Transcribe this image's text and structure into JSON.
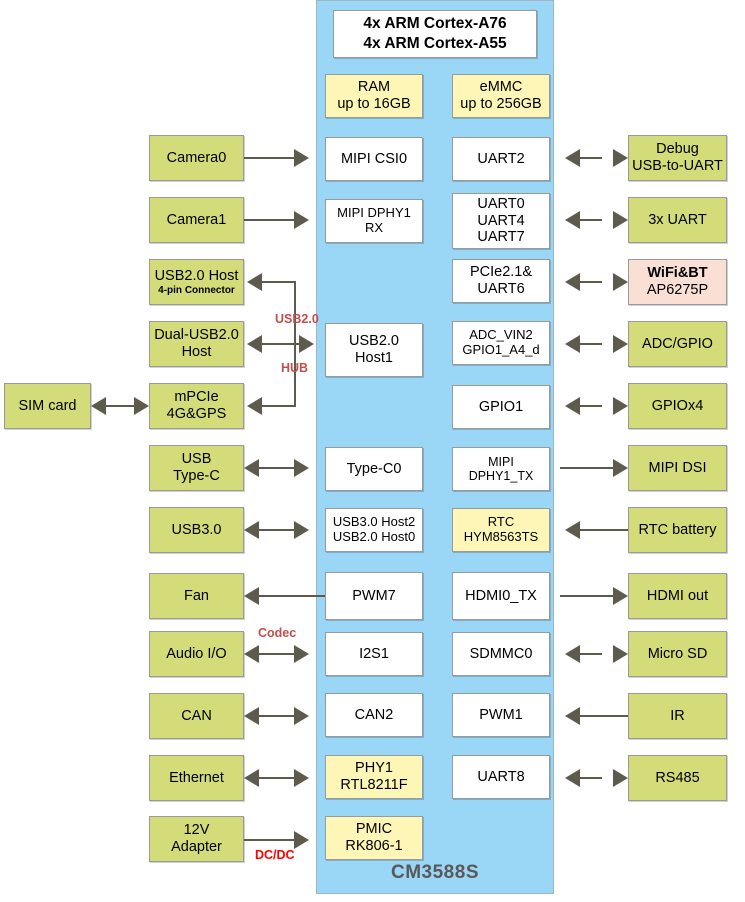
{
  "soc": {
    "name": "CM3588S",
    "panel_color": "#9ad6f5",
    "cpu": {
      "line1": "4x ARM Cortex-A76",
      "line2": "4x ARM Cortex-A55"
    },
    "memory": [
      {
        "id": "ram",
        "line1": "RAM",
        "line2": "up to 16GB"
      },
      {
        "id": "emmc",
        "line1": "eMMC",
        "line2": "up to 256GB"
      }
    ],
    "inner_left": [
      {
        "id": "mipi-csi0",
        "line1": "MIPI CSI0"
      },
      {
        "id": "mipi-dphy1-rx",
        "line1": "MIPI DPHY1 RX"
      },
      {
        "id": "usb20-host1",
        "line1": "USB2.0",
        "line2": "Host1"
      },
      {
        "id": "type-c0",
        "line1": "Type-C0"
      },
      {
        "id": "usb3-host2",
        "line1": "USB3.0 Host2",
        "line2": "USB2.0 Host0"
      },
      {
        "id": "pwm7",
        "line1": "PWM7"
      },
      {
        "id": "i2s1",
        "line1": "I2S1"
      },
      {
        "id": "can2",
        "line1": "CAN2"
      },
      {
        "id": "phy1",
        "line1": "PHY1",
        "line2": "RTL8211F"
      },
      {
        "id": "pmic",
        "line1": "PMIC",
        "line2": "RK806-1"
      }
    ],
    "inner_right": [
      {
        "id": "uart2",
        "line1": "UART2"
      },
      {
        "id": "uart047",
        "line1": "UART0",
        "line2": "UART4",
        "line3": "UART7"
      },
      {
        "id": "pcie21",
        "line1": "PCIe2.1&",
        "line2": "UART6"
      },
      {
        "id": "adc-vin2",
        "line1": "ADC_VIN2",
        "line2": "GPIO1_A4_d"
      },
      {
        "id": "gpio1",
        "line1": "GPIO1"
      },
      {
        "id": "mipi-dphy1-tx",
        "line1": "MIPI DPHY1_TX"
      },
      {
        "id": "rtc",
        "line1": "RTC",
        "line2": "HYM8563TS"
      },
      {
        "id": "hdmi0-tx",
        "line1": "HDMI0_TX"
      },
      {
        "id": "sdmmc0",
        "line1": "SDMMC0"
      },
      {
        "id": "pwm1",
        "line1": "PWM1"
      },
      {
        "id": "uart8",
        "line1": "UART8"
      }
    ]
  },
  "left_peripherals": [
    {
      "id": "camera0",
      "line1": "Camera0"
    },
    {
      "id": "camera1",
      "line1": "Camera1"
    },
    {
      "id": "usb20-host",
      "line1": "USB2.0 Host",
      "line2": "4-pin Connector"
    },
    {
      "id": "dual-usb20",
      "line1": "Dual-USB2.0",
      "line2": "Host"
    },
    {
      "id": "mpcie",
      "line1": "mPCIe",
      "line2": "4G&GPS"
    },
    {
      "id": "usb-typec",
      "line1": "USB",
      "line2": "Type-C"
    },
    {
      "id": "usb30",
      "line1": "USB3.0"
    },
    {
      "id": "fan",
      "line1": "Fan"
    },
    {
      "id": "audio-io",
      "line1": "Audio I/O"
    },
    {
      "id": "can",
      "line1": "CAN"
    },
    {
      "id": "ethernet",
      "line1": "Ethernet"
    },
    {
      "id": "adapter12v",
      "line1": "12V",
      "line2": "Adapter"
    }
  ],
  "far_left": [
    {
      "id": "sim-card",
      "line1": "SIM card"
    }
  ],
  "right_peripherals": [
    {
      "id": "debug",
      "line1": "Debug",
      "line2": "USB-to-UART"
    },
    {
      "id": "uart3x",
      "line1": "3x UART"
    },
    {
      "id": "wifi-bt",
      "line1": "WiFi&BT",
      "line2": "AP6275P"
    },
    {
      "id": "adc-gpio",
      "line1": "ADC/GPIO"
    },
    {
      "id": "gpiox4",
      "line1": "GPIOx4"
    },
    {
      "id": "mipi-dsi",
      "line1": "MIPI DSI"
    },
    {
      "id": "rtc-battery",
      "line1": "RTC battery"
    },
    {
      "id": "hdmi-out",
      "line1": "HDMI out"
    },
    {
      "id": "micro-sd",
      "line1": "Micro SD"
    },
    {
      "id": "ir",
      "line1": "IR"
    },
    {
      "id": "rs485",
      "line1": "RS485"
    }
  ],
  "connector_labels": [
    {
      "id": "usb20-label",
      "text": "USB2.0"
    },
    {
      "id": "hub-label",
      "text": "HUB"
    },
    {
      "id": "codec-label",
      "text": "Codec"
    },
    {
      "id": "dcdc-label",
      "text": "DC/DC"
    }
  ],
  "colors": {
    "panel": "#9ad6f5",
    "green": "#d3dc78",
    "white": "#ffffff",
    "yellow": "#fdf6b6",
    "pink": "#fadfd4",
    "arrow": "#5d5a4e",
    "label_red": "#c0504d",
    "dcdc_red": "#ff0000",
    "title": "#595959"
  }
}
